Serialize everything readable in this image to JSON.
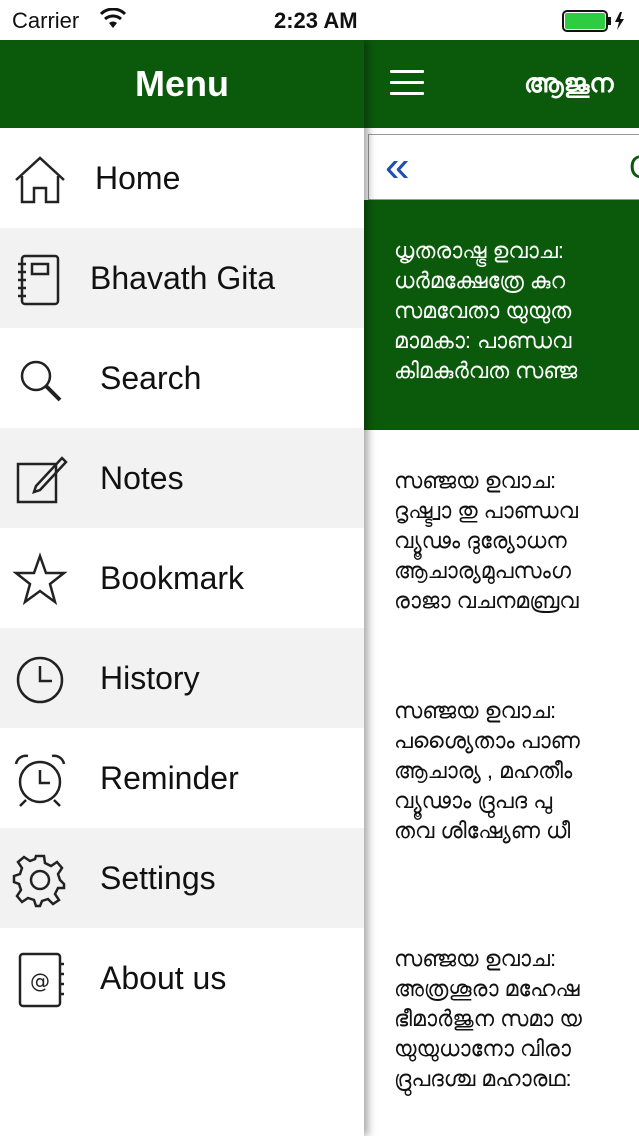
{
  "status_bar": {
    "carrier": "Carrier",
    "time": "2:23 AM"
  },
  "drawer": {
    "title": "Menu",
    "items": [
      {
        "label": "Home",
        "icon": "home-icon"
      },
      {
        "label": "Bhavath Gita",
        "icon": "book-icon"
      },
      {
        "label": "Search",
        "icon": "search-icon"
      },
      {
        "label": "Notes",
        "icon": "notes-icon"
      },
      {
        "label": "Bookmark",
        "icon": "star-icon"
      },
      {
        "label": "History",
        "icon": "clock-icon"
      },
      {
        "label": "Reminder",
        "icon": "alarm-clock-icon"
      },
      {
        "label": "Settings",
        "icon": "gear-icon"
      },
      {
        "label": "About us",
        "icon": "address-book-icon"
      }
    ]
  },
  "main": {
    "title": "ആജൂന",
    "nav_truncated": "C",
    "verses": [
      {
        "lines": [
          "ധൃതരാഷ്ട്ര ഉവാച:",
          "ധർമക്ഷേത്രേ കുറ",
          "സമവേതാ യുയുത",
          "മാമകാ: പാണ്ഡവ",
          "കിമകുർവത സഞ്ജ"
        ]
      },
      {
        "lines": [
          "സഞ്ജയ ഉവാച:",
          "ദൃഷ്ട്വാ തു പാണ്ഡവ",
          "വ്യൂഢം ദുര്യോധന",
          "ആചാര്യമുപസംഗ",
          "രാജാ വചനമബ്രവ"
        ]
      },
      {
        "lines": [
          "സഞ്ജയ ഉവാച:",
          "പശ്യൈതാം പാണ",
          "ആചാര്യ , മഹതീം",
          "വ്യൂഢാം ദ്രുപദ പു",
          "തവ ശിഷ്യേണ ധീ"
        ]
      },
      {
        "lines": [
          "സഞ്ജയ ഉവാച:",
          "അത്രശൂരാ മഹേഷ",
          "ഭീമാർജുന സമാ യ",
          "യുയുധാനോ വിരാ",
          "ദ്രുപദശ്ച മഹാരഥ:"
        ]
      }
    ]
  },
  "colors": {
    "primary_green": "#0b5a0b",
    "accent_blue": "#1f4fb0",
    "battery_green": "#2ecc40"
  }
}
